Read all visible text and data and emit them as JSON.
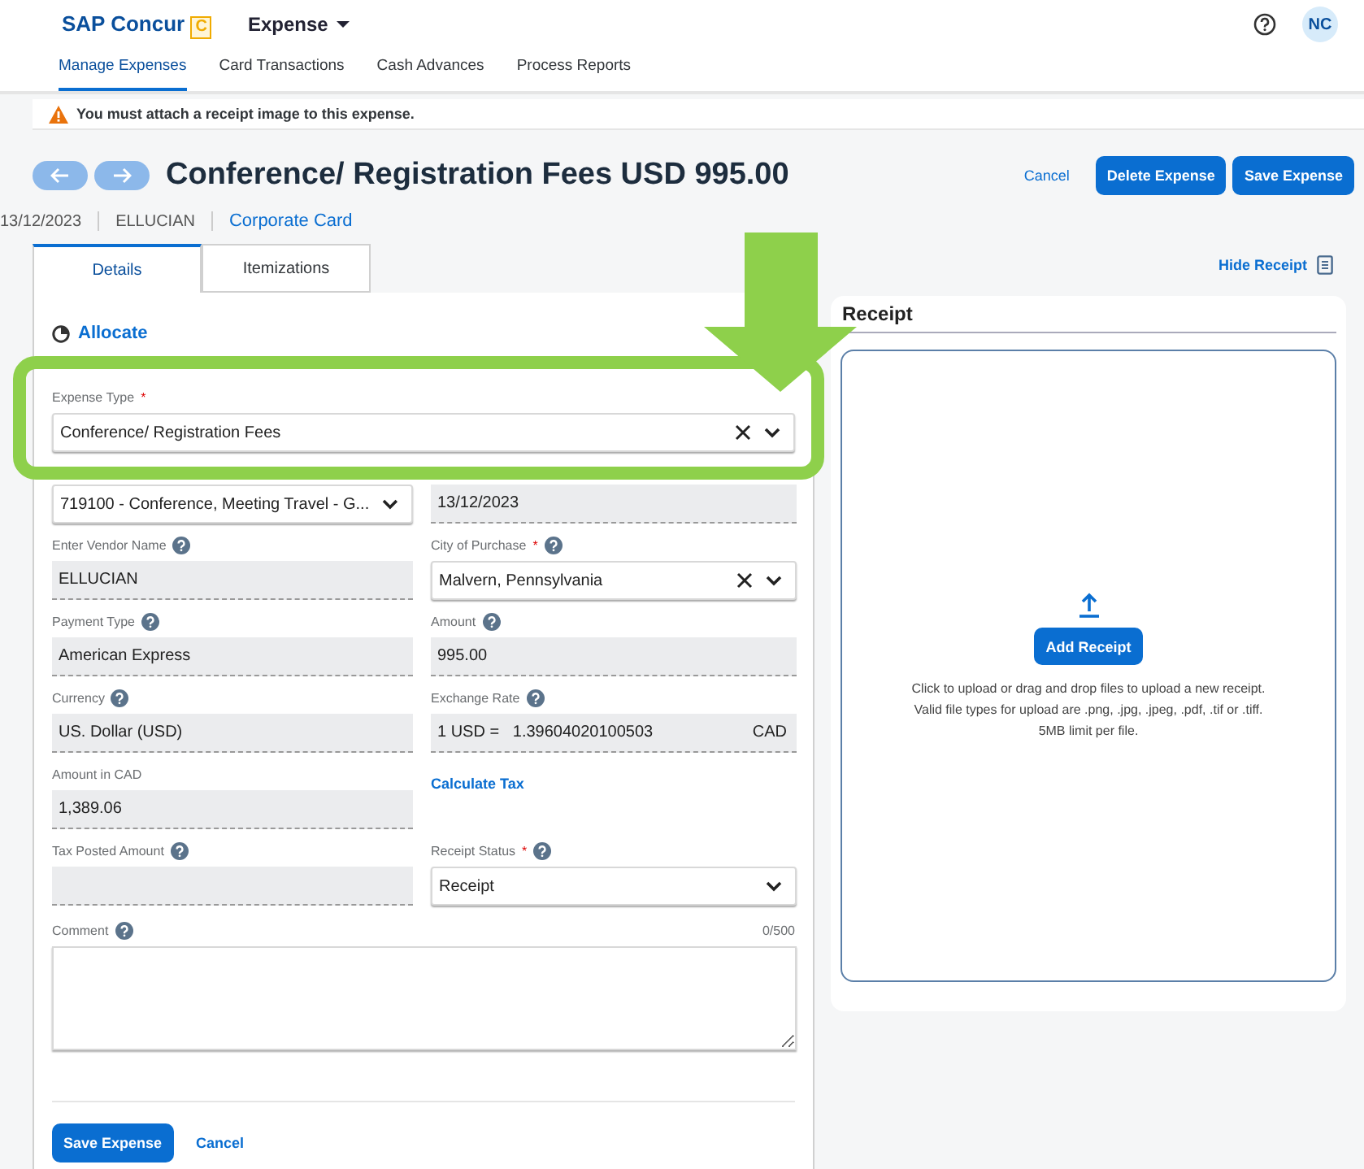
{
  "header": {
    "brand": "SAP Concur",
    "brand_mark": "C",
    "module": "Expense",
    "avatar": "NC"
  },
  "nav_tabs": [
    {
      "label": "Manage Expenses",
      "selected": true
    },
    {
      "label": "Card Transactions",
      "selected": false
    },
    {
      "label": "Cash Advances",
      "selected": false
    },
    {
      "label": "Process Reports",
      "selected": false
    }
  ],
  "alert": {
    "message": "You must attach a receipt image to this expense."
  },
  "expense": {
    "title": "Conference/ Registration Fees USD 995.00",
    "date": "13/12/2023",
    "vendor": "ELLUCIAN",
    "payment": "Corporate Card"
  },
  "actions": [
    {
      "label": "Cancel",
      "kind": "link"
    },
    {
      "label": "Delete Expense",
      "kind": "primary"
    },
    {
      "label": "Save Expense",
      "kind": "primary"
    }
  ],
  "tabs": [
    {
      "label": "Details",
      "selected": true
    },
    {
      "label": "Itemizations",
      "selected": false
    }
  ],
  "hide_receipt": "Hide Receipt",
  "allocate": "Allocate",
  "expense_type": {
    "label": "Expense Type",
    "required_mark": "*",
    "value": "Conference/ Registration Fees"
  },
  "fields": [
    {
      "kind": "select",
      "value": "719100 - Conference, Meeting Travel - G...",
      "help": false
    },
    {
      "kind": "readonly",
      "value": "13/12/2023",
      "help": false
    },
    {
      "kind": "readonly",
      "label": "Enter Vendor Name",
      "help": true,
      "value": "ELLUCIAN"
    },
    {
      "kind": "clearable",
      "label": "City of Purchase",
      "required_mark": "*",
      "help": true,
      "value": "Malvern, Pennsylvania"
    },
    {
      "kind": "readonly",
      "label": "Payment Type",
      "help": true,
      "value": "American Express"
    },
    {
      "kind": "readonly",
      "label": "Amount",
      "help": true,
      "value": "995.00"
    },
    {
      "kind": "readonly",
      "label": "Currency",
      "help": true,
      "value": "US. Dollar (USD)"
    },
    {
      "kind": "rate",
      "label": "Exchange Rate",
      "help": true,
      "prefix": "1 USD =",
      "value": "1.39604020100503",
      "suffix": "CAD"
    },
    {
      "kind": "readonly",
      "label": "Amount in CAD",
      "help": false,
      "value": "1,389.06"
    },
    {
      "kind": "link",
      "value": "Calculate Tax",
      "help": false
    },
    {
      "kind": "readonly",
      "label": "Tax Posted Amount",
      "help": true
    },
    {
      "kind": "select",
      "label": "Receipt Status",
      "required_mark": "*",
      "help": true,
      "value": "Receipt"
    }
  ],
  "comment": {
    "label": "Comment",
    "help": true,
    "counter": "0/500"
  },
  "footer_actions": [
    {
      "label": "Save Expense",
      "kind": "primary"
    },
    {
      "label": "Cancel",
      "kind": "link"
    }
  ],
  "receipt": {
    "title": "Receipt",
    "button": "Add Receipt",
    "instructions": "Click to upload or drag and drop files to upload a new receipt.\nValid file types for upload are .png, .jpg, .jpeg, .pdf, .tif or .tiff.\n5MB limit per file."
  }
}
